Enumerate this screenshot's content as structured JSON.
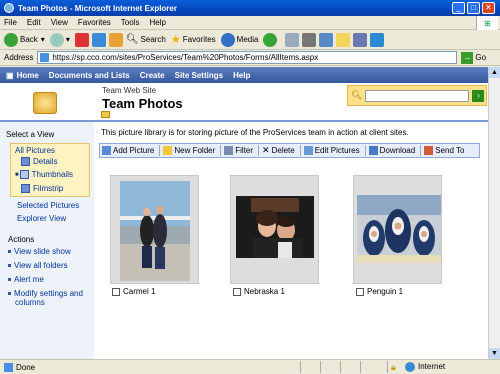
{
  "window": {
    "title": "Team Photos - Microsoft Internet Explorer"
  },
  "menu": [
    "File",
    "Edit",
    "View",
    "Favorites",
    "Tools",
    "Help"
  ],
  "toolbar": {
    "back": "Back",
    "search": "Search",
    "favorites": "Favorites",
    "media": "Media"
  },
  "address": {
    "label": "Address",
    "url": "https://sp.cco.com/sites/ProServices/Team%20Photos/Forms/AllItems.aspx",
    "go": "Go"
  },
  "topnav": [
    "Home",
    "Documents and Lists",
    "Create",
    "Site Settings",
    "Help"
  ],
  "header": {
    "site": "Team Web Site",
    "title": "Team Photos"
  },
  "leftnav": {
    "select_view": "Select a View",
    "views": [
      "All Pictures",
      "Details",
      "Thumbnails",
      "Filmstrip"
    ],
    "selected_pictures": "Selected Pictures",
    "explorer_view": "Explorer View",
    "actions_head": "Actions",
    "actions": [
      "View slide show",
      "View all folders",
      "Alert me",
      "Modify settings and",
      "columns"
    ]
  },
  "main": {
    "description": "This picture library is for storing picture of the ProServices team in action at client sites.",
    "buttons": [
      "Add Picture",
      "New Folder",
      "Filter",
      "Delete",
      "Edit Pictures",
      "Download",
      "Send To"
    ]
  },
  "photos": [
    {
      "caption": "Carmel 1"
    },
    {
      "caption": "Nebraska 1"
    },
    {
      "caption": "Penguin 1"
    }
  ],
  "status": {
    "left": "Done",
    "zone": "Internet"
  }
}
